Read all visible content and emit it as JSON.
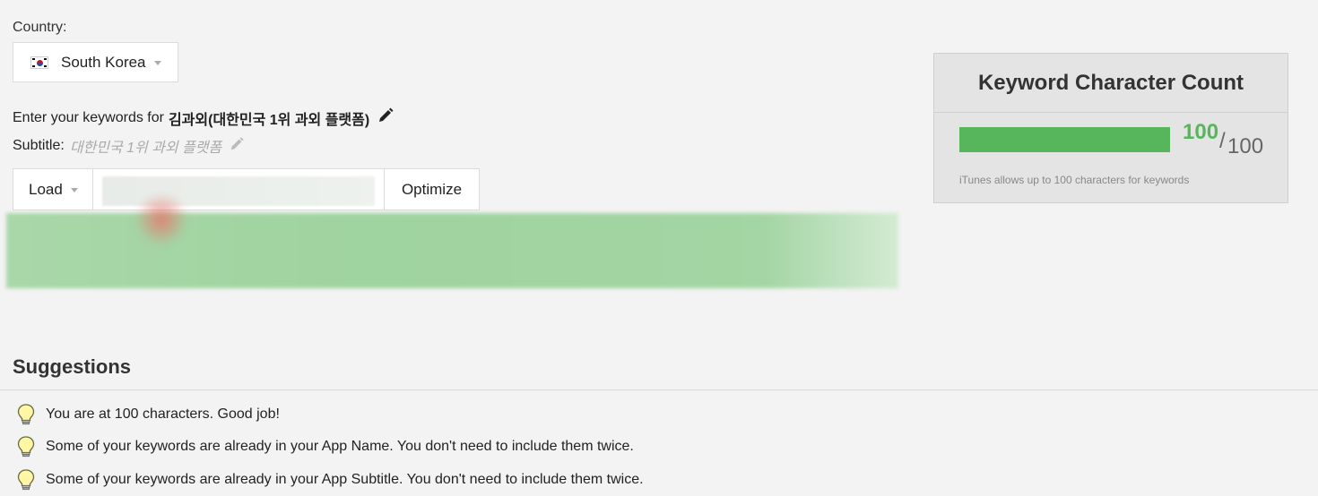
{
  "country": {
    "label": "Country:",
    "selected": "South Korea",
    "flag_icon": "south-korea-flag-icon"
  },
  "keywords": {
    "prefix": "Enter your keywords for",
    "app_name": "김과외(대한민국 1위 과외 플랫폼)",
    "edit_icon": "pencil-icon"
  },
  "subtitle": {
    "label": "Subtitle:",
    "value": "대한민국 1위 과외 플랫폼",
    "edit_icon": "pencil-icon"
  },
  "toolbar": {
    "load_label": "Load",
    "keyword_input_value": "",
    "optimize_label": "Optimize"
  },
  "character_count": {
    "title": "Keyword Character Count",
    "current": "100",
    "slash": "/",
    "max": "100",
    "fill_fraction": 1.0,
    "note": "iTunes allows up to 100 characters for keywords",
    "fill_color": "#57b65c"
  },
  "suggestions": {
    "title": "Suggestions",
    "icon": "lightbulb-icon",
    "items": [
      "You are at 100 characters. Good job!",
      "Some of your keywords are already in your App Name. You don't need to include them twice.",
      "Some of your keywords are already in your App Subtitle. You don't need to include them twice."
    ]
  }
}
